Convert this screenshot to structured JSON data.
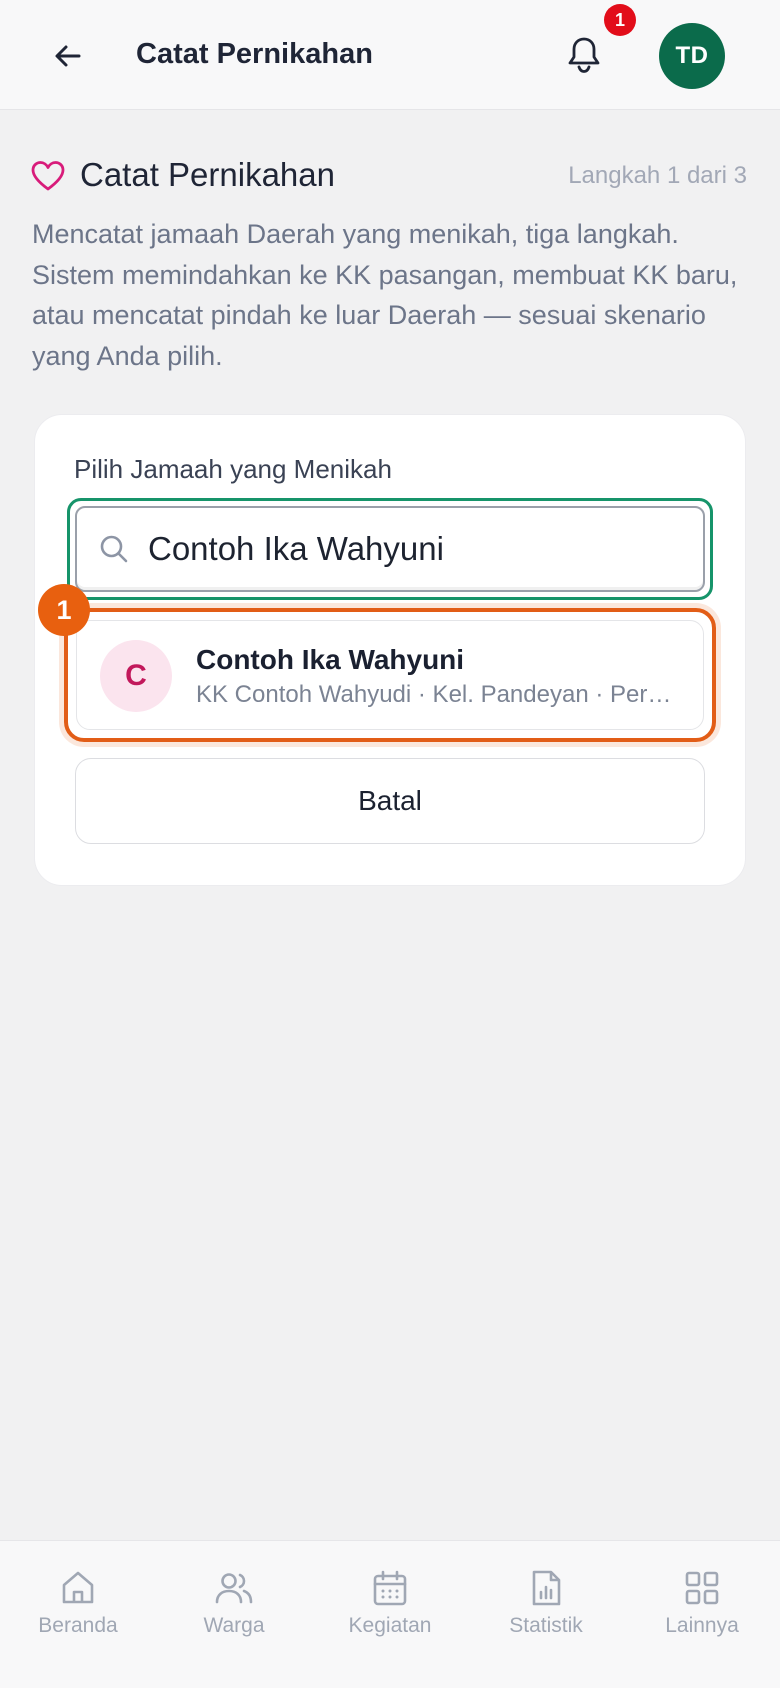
{
  "header": {
    "title": "Catat Pernikahan",
    "notification_count": "1",
    "avatar_initials": "TD"
  },
  "intro": {
    "title": "Catat Pernikahan",
    "step": "Langkah 1 dari 3",
    "description": "Mencatat jamaah Daerah yang menikah, tiga langkah. Sistem memindahkan ke KK pasangan, membuat KK baru, atau mencatat pindah ke luar Daerah — sesuai skenario yang Anda pilih."
  },
  "form": {
    "label": "Pilih Jamaah yang Menikah",
    "search_value": "Contoh Ika Wahyuni",
    "marker_number": "1",
    "result": {
      "initial": "C",
      "name": "Contoh Ika Wahyuni",
      "subtitle": "KK Contoh Wahyudi · Kel. Pandeyan · Pere…"
    },
    "cancel_label": "Batal"
  },
  "nav": {
    "items": [
      {
        "label": "Beranda",
        "icon": "home-icon"
      },
      {
        "label": "Warga",
        "icon": "users-icon"
      },
      {
        "label": "Kegiatan",
        "icon": "calendar-icon"
      },
      {
        "label": "Statistik",
        "icon": "report-icon"
      },
      {
        "label": "Lainnya",
        "icon": "grid-icon"
      }
    ]
  },
  "colors": {
    "brand": "#0b6b4b",
    "focus": "#16946a",
    "highlight": "#e25d17",
    "heart": "#d81b7a",
    "badge": "#e20d1a"
  }
}
